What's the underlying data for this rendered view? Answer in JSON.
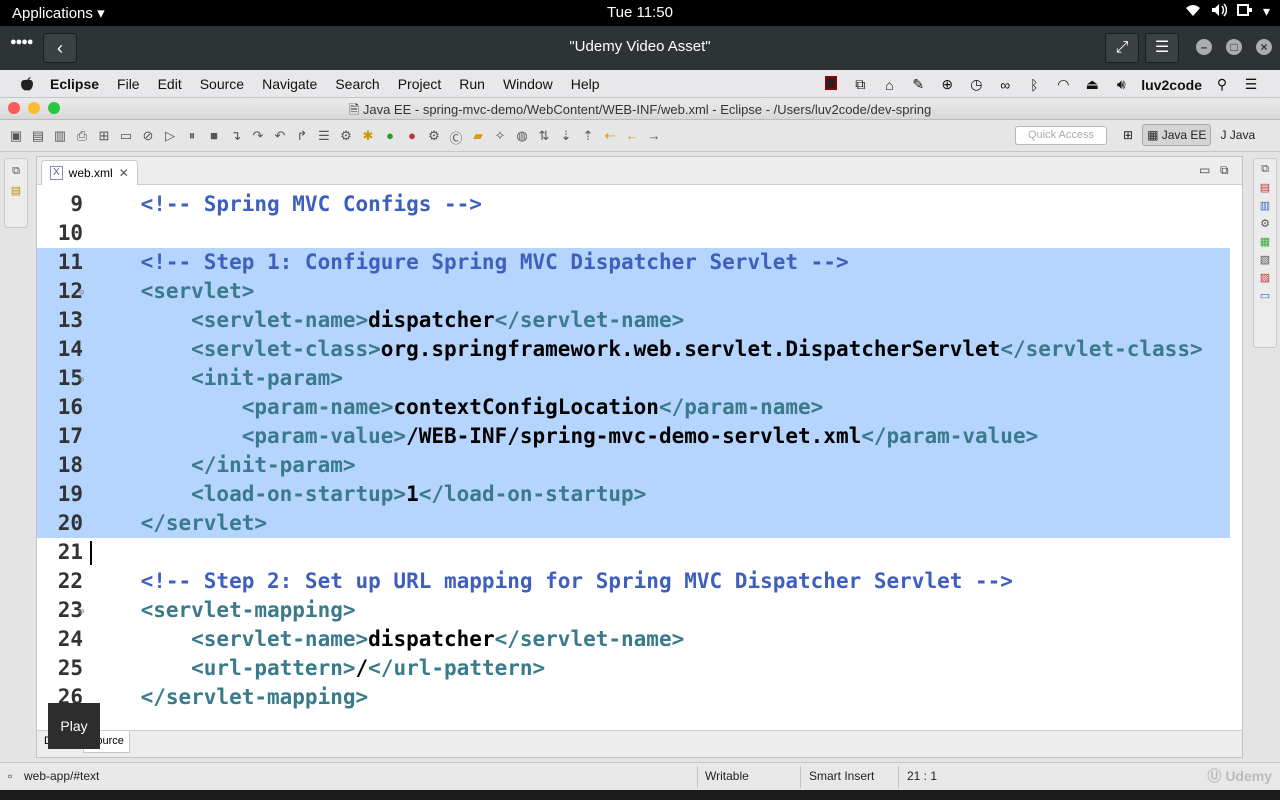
{
  "topbar": {
    "applications": "Applications",
    "applications_arrow": "▾",
    "clock": "Tue 11:50",
    "tray": [
      "wifi-icon",
      "volume-icon",
      "battery-icon",
      "power-icon"
    ]
  },
  "video_header": {
    "title": "\"Udemy Video Asset\""
  },
  "mac_menubar": {
    "app_name": "Eclipse",
    "menus": [
      "File",
      "Edit",
      "Source",
      "Navigate",
      "Search",
      "Project",
      "Run",
      "Window",
      "Help"
    ],
    "user": "luv2code"
  },
  "eclipse_window": {
    "title": "Java EE - spring-mvc-demo/WebContent/WEB-INF/web.xml - Eclipse - /Users/luv2code/dev-spring"
  },
  "toolbar": {
    "quick_access_placeholder": "Quick Access",
    "perspectives": [
      "Java EE",
      "Java"
    ]
  },
  "editor": {
    "tab_label": "web.xml",
    "tab_close": "✕",
    "lines": [
      {
        "num": "9",
        "fold": "",
        "selected": false,
        "parts": [
          [
            "comment",
            "    <!-- Spring MVC Configs -->"
          ]
        ]
      },
      {
        "num": "10",
        "fold": "",
        "selected": false,
        "parts": []
      },
      {
        "num": "11",
        "fold": "",
        "selected": true,
        "parts": [
          [
            "comment",
            "    <!-- Step 1: Configure Spring MVC Dispatcher Servlet -->"
          ]
        ]
      },
      {
        "num": "12",
        "fold": "⊖",
        "selected": true,
        "parts": [
          [
            "tag",
            "    <servlet>"
          ]
        ]
      },
      {
        "num": "13",
        "fold": "",
        "selected": true,
        "parts": [
          [
            "tag",
            "        <servlet-name>"
          ],
          [
            "text",
            "dispatcher"
          ],
          [
            "tag",
            "</servlet-name>"
          ]
        ]
      },
      {
        "num": "14",
        "fold": "",
        "selected": true,
        "parts": [
          [
            "tag",
            "        <servlet-class>"
          ],
          [
            "text",
            "org.springframework.web.servlet.DispatcherServlet"
          ],
          [
            "tag",
            "</servlet-class>"
          ]
        ]
      },
      {
        "num": "15",
        "fold": "⊖",
        "selected": true,
        "parts": [
          [
            "tag",
            "        <init-param>"
          ]
        ]
      },
      {
        "num": "16",
        "fold": "",
        "selected": true,
        "parts": [
          [
            "tag",
            "            <param-name>"
          ],
          [
            "text",
            "contextConfigLocation"
          ],
          [
            "tag",
            "</param-name>"
          ]
        ]
      },
      {
        "num": "17",
        "fold": "",
        "selected": true,
        "parts": [
          [
            "tag",
            "            <param-value>"
          ],
          [
            "text",
            "/WEB-INF/spring-mvc-demo-servlet.xml"
          ],
          [
            "tag",
            "</param-value>"
          ]
        ]
      },
      {
        "num": "18",
        "fold": "",
        "selected": true,
        "parts": [
          [
            "tag",
            "        </init-param>"
          ]
        ]
      },
      {
        "num": "19",
        "fold": "",
        "selected": true,
        "parts": [
          [
            "tag",
            "        <load-on-startup>"
          ],
          [
            "text",
            "1"
          ],
          [
            "tag",
            "</load-on-startup>"
          ]
        ]
      },
      {
        "num": "20",
        "fold": "",
        "selected": true,
        "parts": [
          [
            "tag",
            "    </servlet>"
          ]
        ]
      },
      {
        "num": "21",
        "fold": "",
        "selected": false,
        "parts": []
      },
      {
        "num": "22",
        "fold": "",
        "selected": false,
        "parts": [
          [
            "comment",
            "    <!-- Step 2: Set up URL mapping for Spring MVC Dispatcher Servlet -->"
          ]
        ]
      },
      {
        "num": "23",
        "fold": "⊖",
        "selected": false,
        "parts": [
          [
            "tag",
            "    <servlet-mapping>"
          ]
        ]
      },
      {
        "num": "24",
        "fold": "",
        "selected": false,
        "parts": [
          [
            "tag",
            "        <servlet-name>"
          ],
          [
            "text",
            "dispatcher"
          ],
          [
            "tag",
            "</servlet-name>"
          ]
        ]
      },
      {
        "num": "25",
        "fold": "",
        "selected": false,
        "parts": [
          [
            "tag",
            "        <url-pattern>"
          ],
          [
            "text",
            "/"
          ],
          [
            "tag",
            "</url-pattern>"
          ]
        ]
      },
      {
        "num": "26",
        "fold": "",
        "selected": false,
        "parts": [
          [
            "tag",
            "    </servlet-mapping>"
          ]
        ]
      }
    ],
    "bottom_tabs": [
      "Design",
      "Source"
    ],
    "active_bottom_tab": "Source"
  },
  "player": {
    "play_label": "Play"
  },
  "statusbar": {
    "path": "web-app/#text",
    "mode": "Writable",
    "insert_mode": "Smart Insert",
    "position": "21 : 1",
    "watermark": "Udemy"
  },
  "colors": {
    "selection": "#b5d5ff",
    "comment": "#3f5fbf",
    "tag": "#3a7a8a",
    "text": "#000000"
  }
}
